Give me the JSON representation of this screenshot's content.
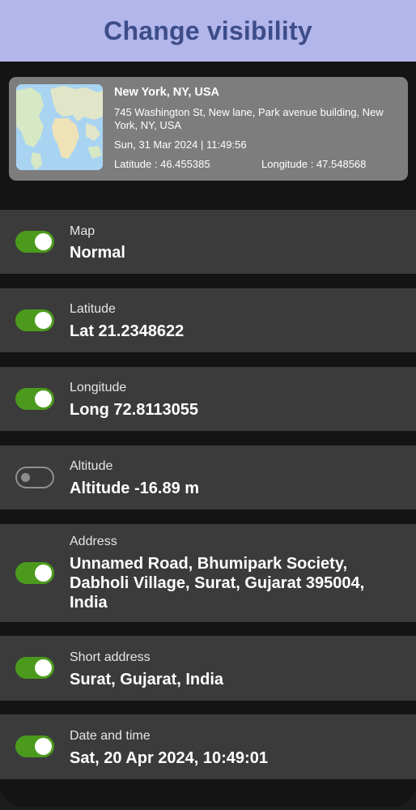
{
  "header": {
    "title": "Change visibility"
  },
  "location_card": {
    "title": "New York, NY, USA",
    "address": "745 Washington St, New lane, Park avenue building, New York, NY, USA",
    "datetime": "Sun, 31 Mar 2024 | 11:49:56",
    "latitude": "Latitude : 46.455385",
    "longitude": "Longitude : 47.548568"
  },
  "settings": [
    {
      "label": "Map",
      "value": "Normal",
      "enabled": true
    },
    {
      "label": "Latitude",
      "value": "Lat  21.2348622",
      "enabled": true
    },
    {
      "label": "Longitude",
      "value": "Long  72.8113055",
      "enabled": true
    },
    {
      "label": "Altitude",
      "value": "Altitude  -16.89 m",
      "enabled": false
    },
    {
      "label": "Address",
      "value": "Unnamed Road, Bhumipark Society, Dabholi Village, Surat, Gujarat 395004, India",
      "enabled": true
    },
    {
      "label": "Short address",
      "value": "Surat, Gujarat, India",
      "enabled": true
    },
    {
      "label": "Date and time",
      "value": "Sat, 20 Apr 2024, 10:49:01",
      "enabled": true
    }
  ]
}
